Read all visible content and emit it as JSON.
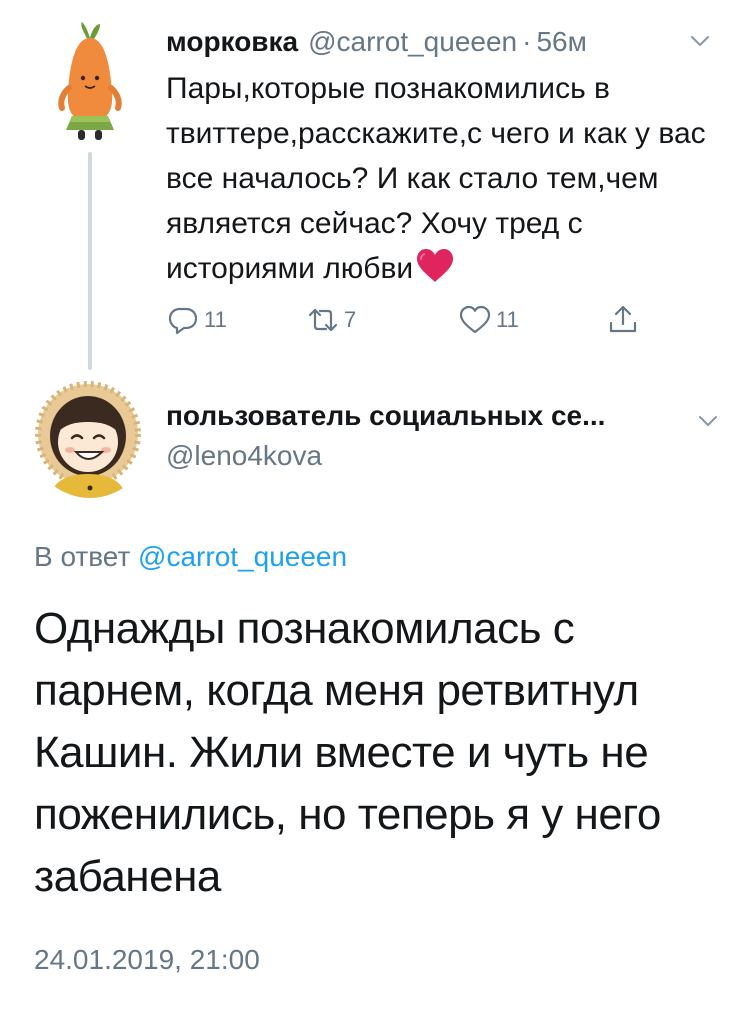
{
  "parent_tweet": {
    "author_name": "морковка",
    "author_handle": "@carrot_queeen",
    "separator": "·",
    "time_ago": "56м",
    "text": "Пары,которые познакомились в твиттере,расскажите,с чего и как у вас все началось? И как стало тем,чем является сейчас? Хочу тред с историями любви",
    "text_emoji": "heart-emoji",
    "avatar_icon": "carrot-plush-avatar",
    "actions": {
      "reply": {
        "icon": "reply-icon",
        "count": "11"
      },
      "retweet": {
        "icon": "retweet-icon",
        "count": "7"
      },
      "like": {
        "icon": "like-heart-icon",
        "count": "11"
      },
      "share": {
        "icon": "share-icon"
      }
    }
  },
  "reply_tweet": {
    "author_name": "пользователь социальных се...",
    "author_handle": "@leno4kova",
    "avatar_icon": "smiling-face-avatar",
    "reply_prefix": "В ответ",
    "reply_mention": "@carrot_queeen",
    "text": "Однажды познакомилась с парнем, когда меня ретвитнул Кашин. Жили вместе и чуть не поженились, но теперь я у него забанена",
    "timestamp": "24.01.2019, 21:00"
  },
  "colors": {
    "text": "#14171a",
    "secondary": "#657786",
    "link": "#1da1f2",
    "thread_line": "#cfd9de",
    "heart": "#e0245e"
  }
}
